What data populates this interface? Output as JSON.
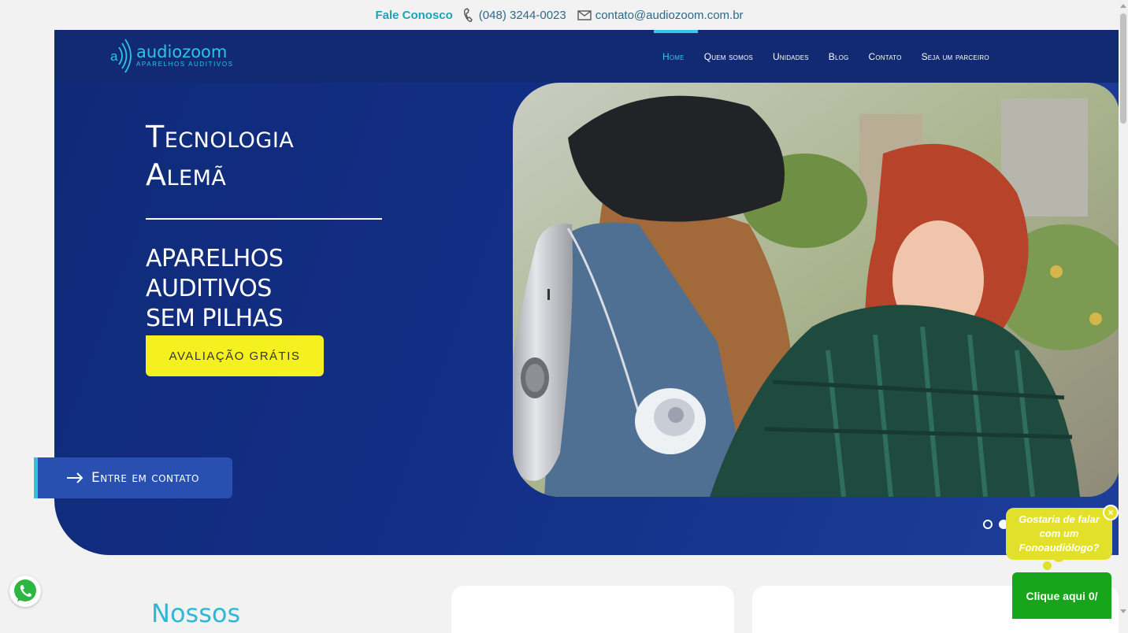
{
  "topbar": {
    "fale": "Fale Conosco",
    "phone": "(048) 3244-0023",
    "email": "contato@audiozoom.com.br",
    "phone_icon": "phone-icon",
    "email_icon": "envelope-icon"
  },
  "logo": {
    "name": "audiozoom",
    "tagline": "APARELHOS AUDITIVOS",
    "icon": "audiozoom-logo-icon"
  },
  "nav": [
    {
      "label": "Home",
      "active": true
    },
    {
      "label": "Quem somos"
    },
    {
      "label": "Unidades"
    },
    {
      "label": "Blog"
    },
    {
      "label": "Contato"
    },
    {
      "label": "Seja um parceiro"
    }
  ],
  "hero": {
    "title_line1": "Tecnologia",
    "title_line2": "Alemã",
    "subtitle_line1": "APARELHOS",
    "subtitle_line2": "AUDITIVOS",
    "subtitle_line3": "SEM PILHAS",
    "cta": "AVALIAÇÃO GRÁTIS",
    "slides_total": 2,
    "slide_active": 2
  },
  "contact_button": {
    "label": "Entre em contato",
    "icon": "arrow-right-icon"
  },
  "section": {
    "heading": "Nossos"
  },
  "chat": {
    "bubble": "Gostaria de falar com um Fonoaudiólogo?",
    "close": "×",
    "button": "Clique aqui 0/"
  },
  "whatsapp": {
    "icon": "whatsapp-icon"
  },
  "colors": {
    "brand_blue": "#132f86",
    "accent_cyan": "#35c7e3",
    "cta_yellow": "#f5f020",
    "chat_green": "#16a51b",
    "bubble_yellow": "#e2e02a"
  }
}
